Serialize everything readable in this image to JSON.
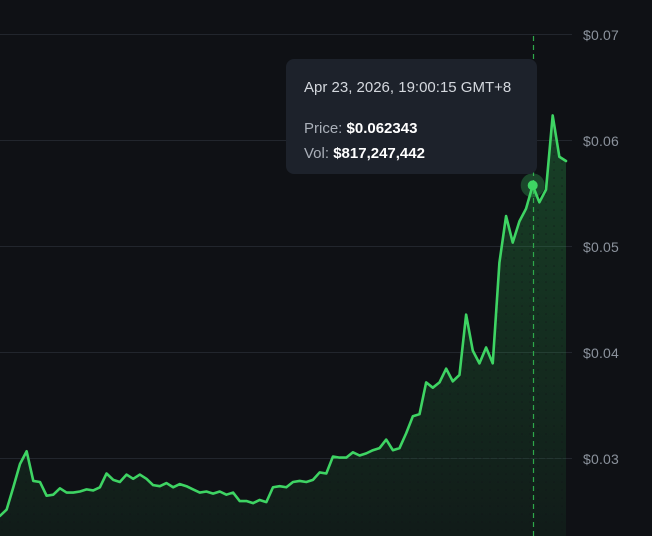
{
  "colors": {
    "background": "#0f1115",
    "line": "#3ed463",
    "grid": "#22262d",
    "crosshair": "#2ea84a",
    "tooltip_bg": "#1d222b"
  },
  "tooltip": {
    "date": "Apr 23, 2026, 19:00:15 GMT+8",
    "price_label": "Price:",
    "price_value": "$0.062343",
    "vol_label": "Vol:",
    "vol_value": "$817,247,442"
  },
  "chart_data": {
    "type": "area",
    "ylim": [
      0.0226,
      0.0732
    ],
    "yticks": [
      0.03,
      0.04,
      0.05,
      0.06,
      0.07
    ],
    "ytick_labels": [
      "$0.03",
      "$0.04",
      "$0.05",
      "$0.06",
      "$0.07"
    ],
    "grid": "horizontal",
    "highlight_index": 80,
    "series": [
      {
        "values": [
          0.0245,
          0.0251,
          0.0272,
          0.0294,
          0.0306,
          0.0278,
          0.0277,
          0.0264,
          0.0265,
          0.0271,
          0.0267,
          0.0267,
          0.0268,
          0.027,
          0.0269,
          0.0272,
          0.0285,
          0.0279,
          0.0277,
          0.0284,
          0.028,
          0.0284,
          0.028,
          0.0274,
          0.0273,
          0.0276,
          0.0272,
          0.0275,
          0.0273,
          0.027,
          0.0267,
          0.0268,
          0.0266,
          0.0268,
          0.0265,
          0.0267,
          0.0259,
          0.0259,
          0.0257,
          0.026,
          0.0258,
          0.0272,
          0.0273,
          0.0272,
          0.0277,
          0.0278,
          0.0277,
          0.0279,
          0.0286,
          0.0285,
          0.0301,
          0.03,
          0.03,
          0.0305,
          0.0302,
          0.0304,
          0.0307,
          0.0309,
          0.0317,
          0.0307,
          0.0309,
          0.0323,
          0.0339,
          0.0341,
          0.0371,
          0.0366,
          0.0371,
          0.0384,
          0.0372,
          0.0378,
          0.0435,
          0.0401,
          0.0389,
          0.0404,
          0.0389,
          0.0484,
          0.0528,
          0.0503,
          0.0523,
          0.0535,
          0.0557,
          0.0541,
          0.0553,
          0.0623,
          0.0584,
          0.058
        ]
      }
    ]
  }
}
